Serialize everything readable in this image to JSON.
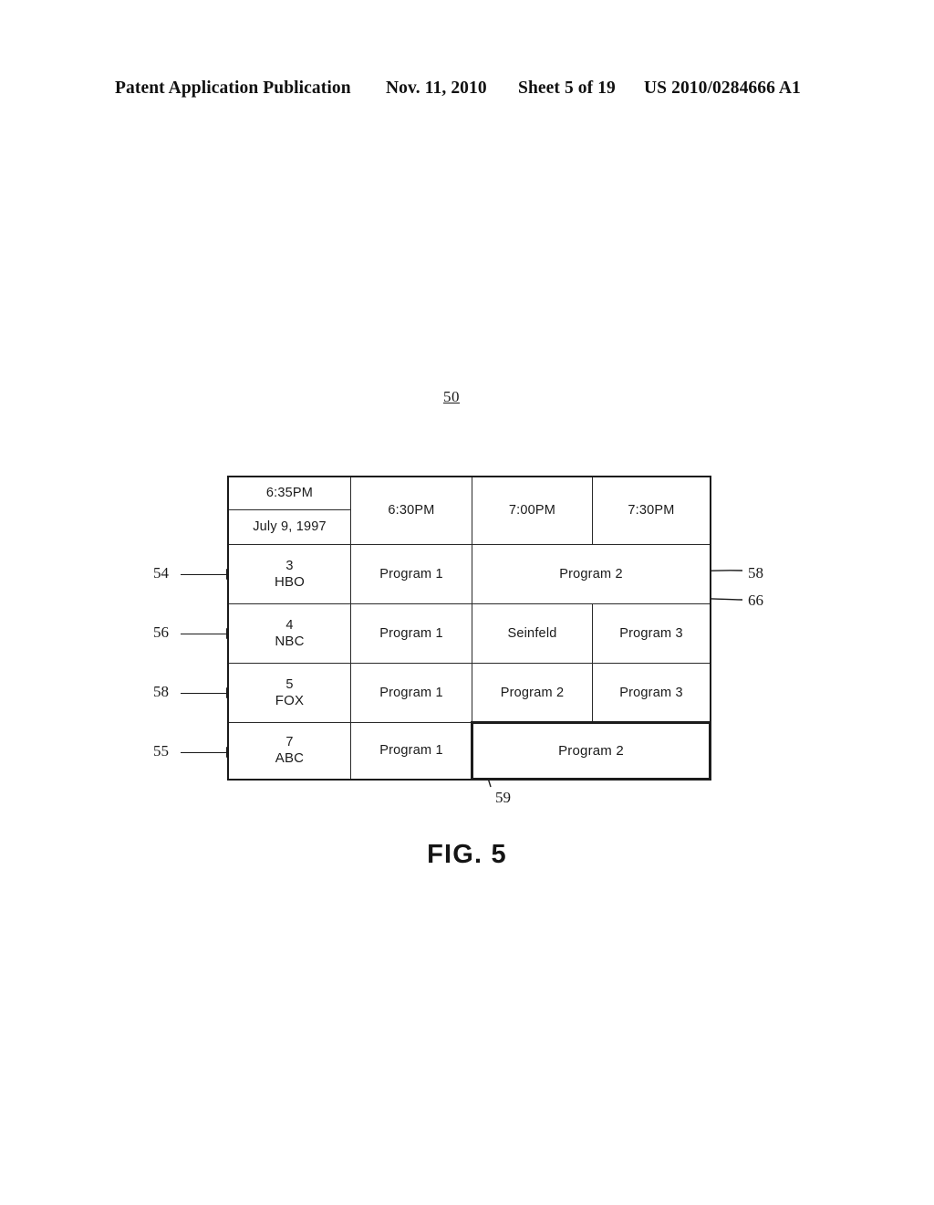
{
  "header": {
    "publication": "Patent Application Publication",
    "date": "Nov. 11, 2010",
    "sheet": "Sheet 5 of 19",
    "document_number": "US 2010/0284666 A1"
  },
  "figure": {
    "caption": "FIG. 5",
    "figure_reference": "50"
  },
  "guide": {
    "clock_time": "6:35PM",
    "date": "July 9, 1997",
    "time_columns": [
      "6:30PM",
      "7:00PM",
      "7:30PM"
    ],
    "rows": [
      {
        "ref": "54",
        "channel_number": "3",
        "channel_name": "HBO",
        "programs": [
          {
            "title": "Program 1",
            "span": 1
          },
          {
            "title": "Program 2",
            "span": 2
          }
        ]
      },
      {
        "ref": "56",
        "channel_number": "4",
        "channel_name": "NBC",
        "programs": [
          {
            "title": "Program 1",
            "span": 1
          },
          {
            "title": "Seinfeld",
            "span": 1
          },
          {
            "title": "Program 3",
            "span": 1
          }
        ]
      },
      {
        "ref": "58",
        "channel_number": "5",
        "channel_name": "FOX",
        "programs": [
          {
            "title": "Program 1",
            "span": 1
          },
          {
            "title": "Program 2",
            "span": 1
          },
          {
            "title": "Program 3",
            "span": 1
          }
        ]
      },
      {
        "ref": "55",
        "channel_number": "7",
        "channel_name": "ABC",
        "programs": [
          {
            "title": "Program 1",
            "span": 1
          },
          {
            "title": "Program 2",
            "span": 2,
            "highlighted": true
          }
        ]
      }
    ]
  },
  "callouts": {
    "left": [
      "54",
      "56",
      "58",
      "55"
    ],
    "right": [
      "58",
      "66"
    ],
    "bottom": "59"
  },
  "colors": {
    "ink": "#1a1a1a",
    "paper": "#ffffff"
  }
}
